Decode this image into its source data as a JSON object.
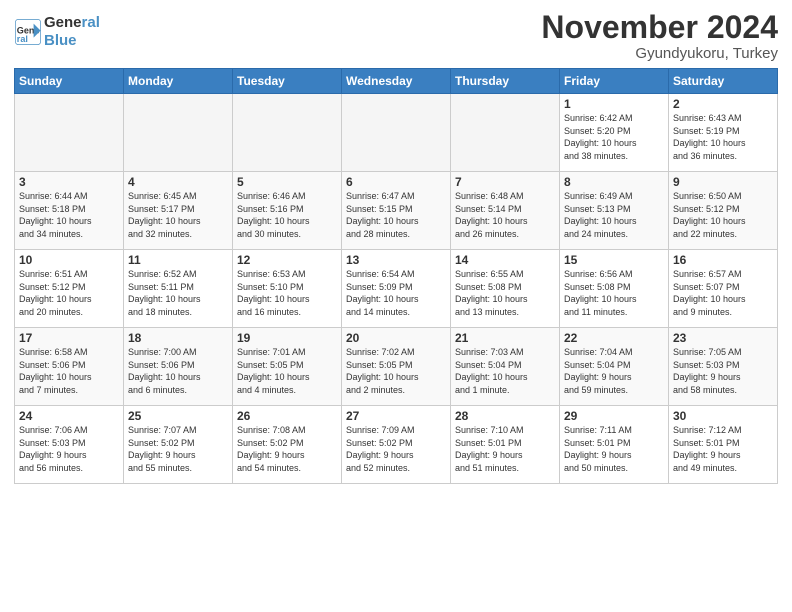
{
  "logo": {
    "line1": "General",
    "line2": "Blue"
  },
  "title": "November 2024",
  "location": "Gyundyukoru, Turkey",
  "days_of_week": [
    "Sunday",
    "Monday",
    "Tuesday",
    "Wednesday",
    "Thursday",
    "Friday",
    "Saturday"
  ],
  "weeks": [
    [
      {
        "day": "",
        "info": ""
      },
      {
        "day": "",
        "info": ""
      },
      {
        "day": "",
        "info": ""
      },
      {
        "day": "",
        "info": ""
      },
      {
        "day": "",
        "info": ""
      },
      {
        "day": "1",
        "info": "Sunrise: 6:42 AM\nSunset: 5:20 PM\nDaylight: 10 hours\nand 38 minutes."
      },
      {
        "day": "2",
        "info": "Sunrise: 6:43 AM\nSunset: 5:19 PM\nDaylight: 10 hours\nand 36 minutes."
      }
    ],
    [
      {
        "day": "3",
        "info": "Sunrise: 6:44 AM\nSunset: 5:18 PM\nDaylight: 10 hours\nand 34 minutes."
      },
      {
        "day": "4",
        "info": "Sunrise: 6:45 AM\nSunset: 5:17 PM\nDaylight: 10 hours\nand 32 minutes."
      },
      {
        "day": "5",
        "info": "Sunrise: 6:46 AM\nSunset: 5:16 PM\nDaylight: 10 hours\nand 30 minutes."
      },
      {
        "day": "6",
        "info": "Sunrise: 6:47 AM\nSunset: 5:15 PM\nDaylight: 10 hours\nand 28 minutes."
      },
      {
        "day": "7",
        "info": "Sunrise: 6:48 AM\nSunset: 5:14 PM\nDaylight: 10 hours\nand 26 minutes."
      },
      {
        "day": "8",
        "info": "Sunrise: 6:49 AM\nSunset: 5:13 PM\nDaylight: 10 hours\nand 24 minutes."
      },
      {
        "day": "9",
        "info": "Sunrise: 6:50 AM\nSunset: 5:12 PM\nDaylight: 10 hours\nand 22 minutes."
      }
    ],
    [
      {
        "day": "10",
        "info": "Sunrise: 6:51 AM\nSunset: 5:12 PM\nDaylight: 10 hours\nand 20 minutes."
      },
      {
        "day": "11",
        "info": "Sunrise: 6:52 AM\nSunset: 5:11 PM\nDaylight: 10 hours\nand 18 minutes."
      },
      {
        "day": "12",
        "info": "Sunrise: 6:53 AM\nSunset: 5:10 PM\nDaylight: 10 hours\nand 16 minutes."
      },
      {
        "day": "13",
        "info": "Sunrise: 6:54 AM\nSunset: 5:09 PM\nDaylight: 10 hours\nand 14 minutes."
      },
      {
        "day": "14",
        "info": "Sunrise: 6:55 AM\nSunset: 5:08 PM\nDaylight: 10 hours\nand 13 minutes."
      },
      {
        "day": "15",
        "info": "Sunrise: 6:56 AM\nSunset: 5:08 PM\nDaylight: 10 hours\nand 11 minutes."
      },
      {
        "day": "16",
        "info": "Sunrise: 6:57 AM\nSunset: 5:07 PM\nDaylight: 10 hours\nand 9 minutes."
      }
    ],
    [
      {
        "day": "17",
        "info": "Sunrise: 6:58 AM\nSunset: 5:06 PM\nDaylight: 10 hours\nand 7 minutes."
      },
      {
        "day": "18",
        "info": "Sunrise: 7:00 AM\nSunset: 5:06 PM\nDaylight: 10 hours\nand 6 minutes."
      },
      {
        "day": "19",
        "info": "Sunrise: 7:01 AM\nSunset: 5:05 PM\nDaylight: 10 hours\nand 4 minutes."
      },
      {
        "day": "20",
        "info": "Sunrise: 7:02 AM\nSunset: 5:05 PM\nDaylight: 10 hours\nand 2 minutes."
      },
      {
        "day": "21",
        "info": "Sunrise: 7:03 AM\nSunset: 5:04 PM\nDaylight: 10 hours\nand 1 minute."
      },
      {
        "day": "22",
        "info": "Sunrise: 7:04 AM\nSunset: 5:04 PM\nDaylight: 9 hours\nand 59 minutes."
      },
      {
        "day": "23",
        "info": "Sunrise: 7:05 AM\nSunset: 5:03 PM\nDaylight: 9 hours\nand 58 minutes."
      }
    ],
    [
      {
        "day": "24",
        "info": "Sunrise: 7:06 AM\nSunset: 5:03 PM\nDaylight: 9 hours\nand 56 minutes."
      },
      {
        "day": "25",
        "info": "Sunrise: 7:07 AM\nSunset: 5:02 PM\nDaylight: 9 hours\nand 55 minutes."
      },
      {
        "day": "26",
        "info": "Sunrise: 7:08 AM\nSunset: 5:02 PM\nDaylight: 9 hours\nand 54 minutes."
      },
      {
        "day": "27",
        "info": "Sunrise: 7:09 AM\nSunset: 5:02 PM\nDaylight: 9 hours\nand 52 minutes."
      },
      {
        "day": "28",
        "info": "Sunrise: 7:10 AM\nSunset: 5:01 PM\nDaylight: 9 hours\nand 51 minutes."
      },
      {
        "day": "29",
        "info": "Sunrise: 7:11 AM\nSunset: 5:01 PM\nDaylight: 9 hours\nand 50 minutes."
      },
      {
        "day": "30",
        "info": "Sunrise: 7:12 AM\nSunset: 5:01 PM\nDaylight: 9 hours\nand 49 minutes."
      }
    ]
  ]
}
